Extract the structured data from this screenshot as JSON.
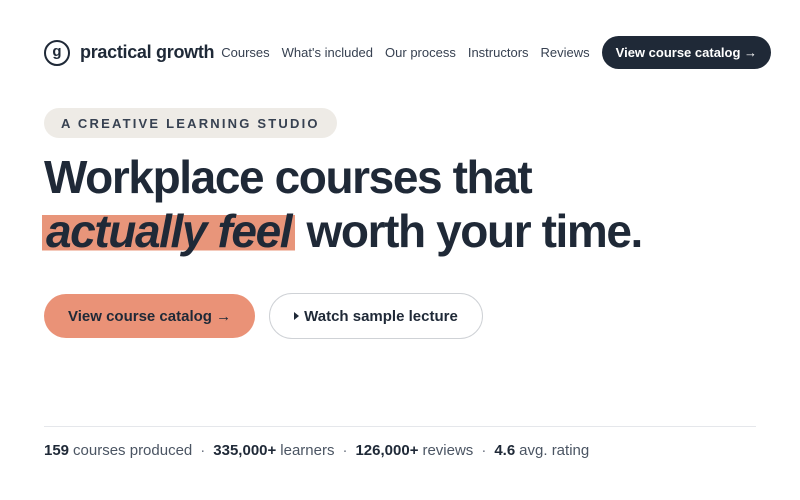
{
  "brand": {
    "logo_letter": "g",
    "name": "practical growth"
  },
  "nav": {
    "items": [
      "Courses",
      "What's included",
      "Our process",
      "Instructors",
      "Reviews"
    ],
    "cta_label": "View course catalog →"
  },
  "hero": {
    "eyebrow": "A CREATIVE LEARNING STUDIO",
    "headline_line1": "Workplace courses that",
    "headline_highlight": "actually feel",
    "headline_rest": " worth your time.",
    "primary_button": "View course catalog →",
    "secondary_button": "Watch sample lecture"
  },
  "stats": [
    {
      "value": "159",
      "label": "courses produced"
    },
    {
      "value": "335,000+",
      "label": "learners"
    },
    {
      "value": "126,000+",
      "label": "reviews"
    },
    {
      "value": "4.6",
      "label": "avg. rating"
    }
  ],
  "stats_separator": "·",
  "colors": {
    "dark": "#1f2937",
    "accent": "#ea9277",
    "eyebrow_bg": "#eeebe6"
  }
}
